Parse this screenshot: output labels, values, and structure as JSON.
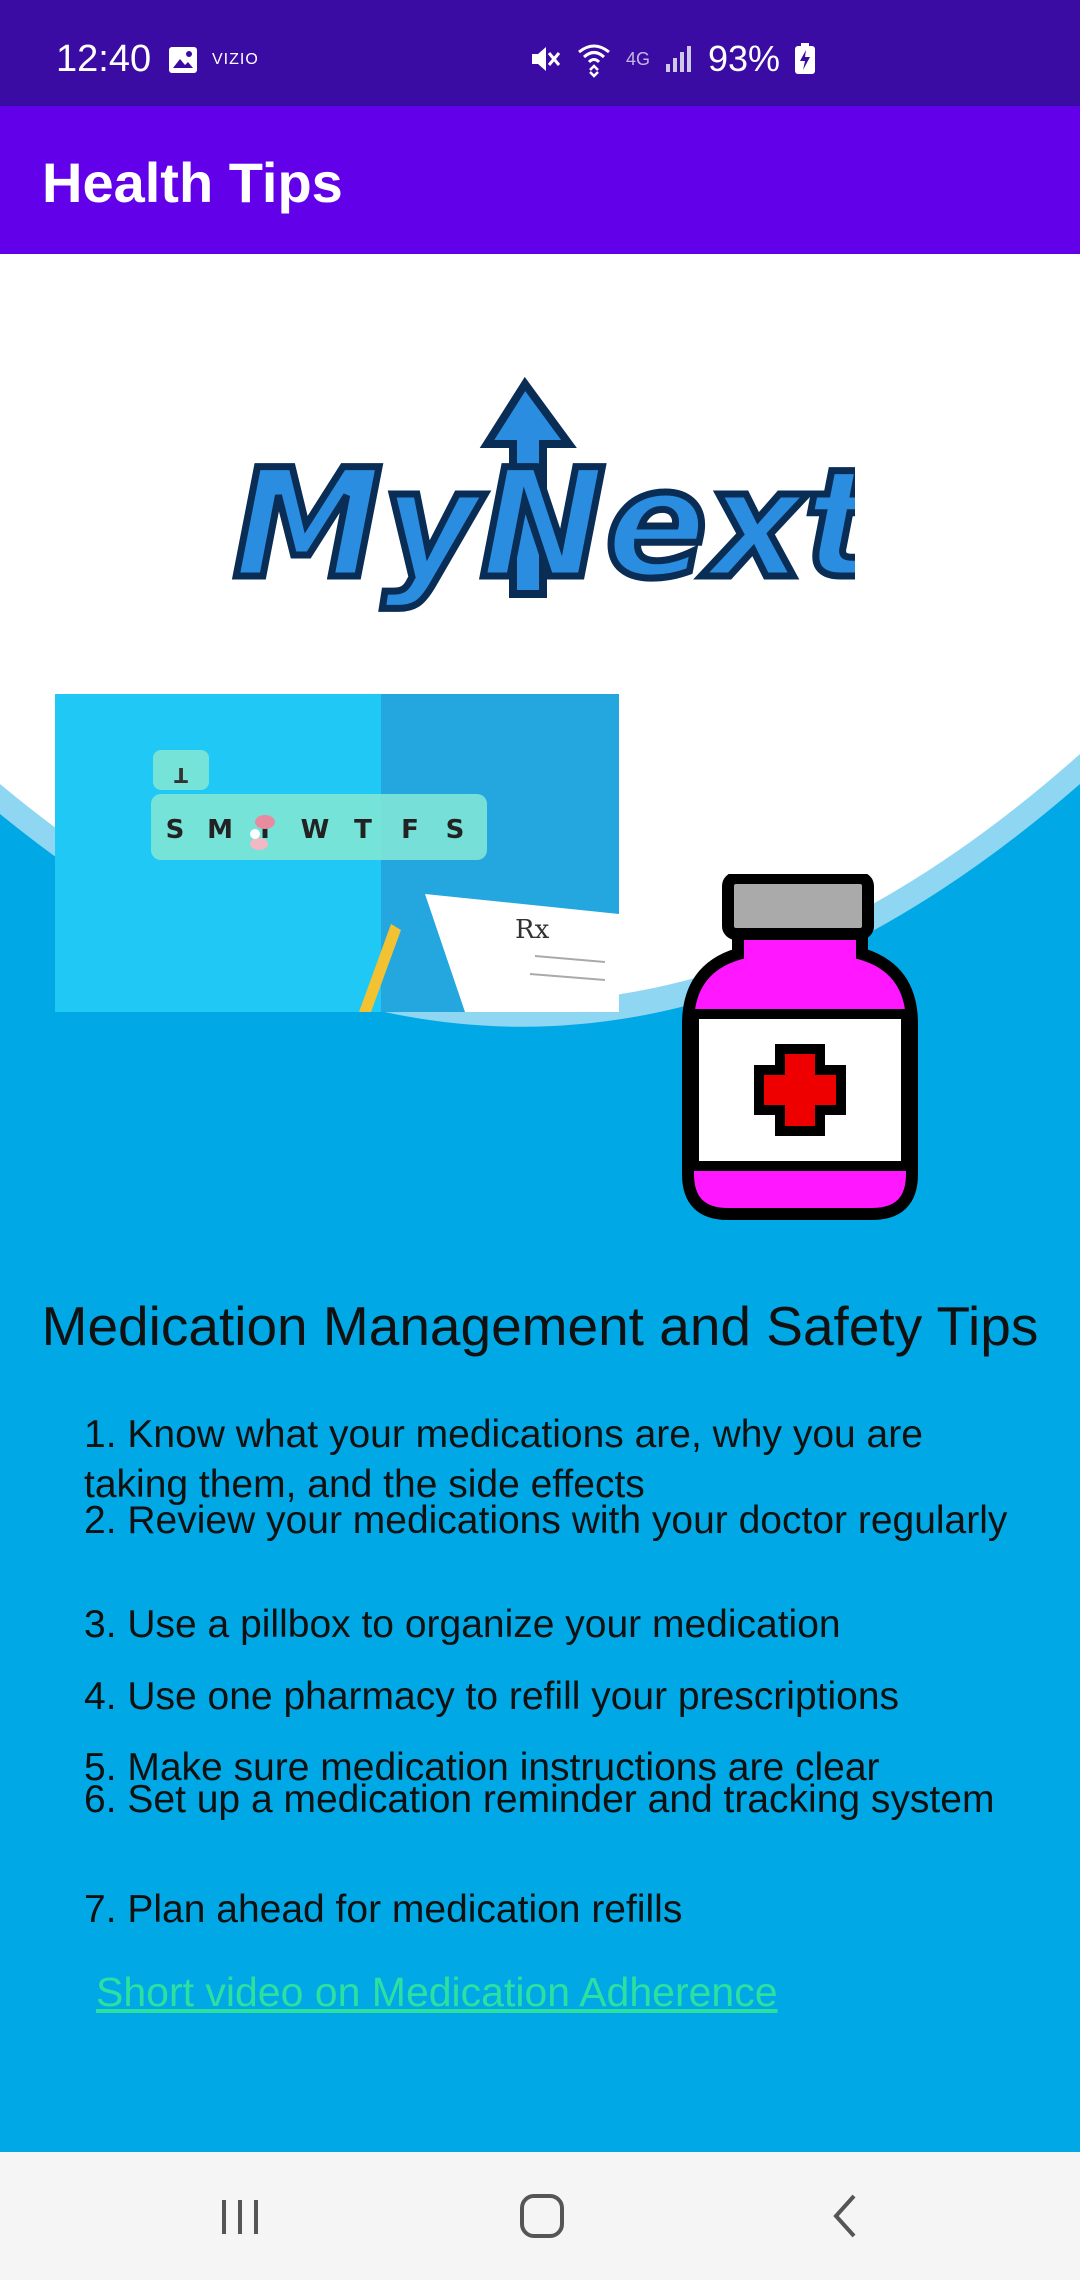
{
  "status_bar": {
    "time": "12:40",
    "vizio": "VIZIO",
    "network": "4G",
    "battery": "93%"
  },
  "app_bar": {
    "title": "Health Tips"
  },
  "logo_text": "MyNextLvL",
  "pill_organizer_days": [
    "S",
    "M",
    "T",
    "W",
    "T",
    "F",
    "S"
  ],
  "pill_organizer_lid": "T",
  "prescription_symbol": "Rx",
  "tips": {
    "heading": "Medication Management and Safety Tips",
    "items": [
      "1. Know what your medications are, why you are taking them, and the side effects",
      "2. Review your medications with your doctor regularly",
      "3. Use a pillbox to organize your medication",
      "4. Use one pharmacy to refill your prescriptions",
      "5. Make sure medication instructions are clear",
      "6. Set up a medication reminder and tracking system",
      "7. Plan ahead for medication refills"
    ]
  },
  "video_link": "Short video on Medication Adherence",
  "colors": {
    "status_bar": "#3a0ca3",
    "app_bar": "#6200ea",
    "content_blue": "#00a8e6",
    "link": "#2ee0a0"
  }
}
